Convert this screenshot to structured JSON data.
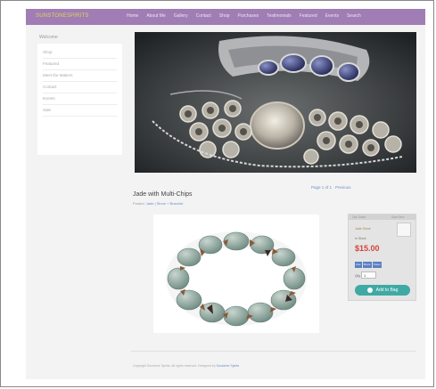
{
  "site": {
    "logo": "SUNSTONESPIRITS",
    "nav": [
      "Home",
      "About Me",
      "Gallery",
      "Contact",
      "Shop",
      "Purchases",
      "Testimonials",
      "Featured",
      "Events",
      "Search"
    ]
  },
  "sidebar": {
    "title": "Welcome",
    "items": [
      "Shop",
      "Featured",
      "Meet the Makers",
      "Contact",
      "Events",
      "Sale"
    ]
  },
  "hero": {
    "icon": "hero-photo"
  },
  "product": {
    "pager": "Page 1 of 1 · Previous",
    "title": "Jade with Multi-Chips",
    "category_prefix": "Posted:",
    "category_links": "Jade | Stone + Bracelet"
  },
  "buybox": {
    "head_left": "Like  Share",
    "head_right": "Save Item",
    "line1": "Jade Stone",
    "line2": "In Stock",
    "price": "$15.00",
    "social": [
      "Like",
      "Share",
      "Tweet"
    ],
    "qty_label": "Qty",
    "qty_value": "1",
    "cart_label": "Add to Bag"
  },
  "footer": {
    "text": "Copyright Sunstone Spirits. All rights reserved. Designed by",
    "link": "Sunstone Spirits"
  },
  "colors": {
    "topbar": "#a07db4",
    "logo": "#e5d35a",
    "price": "#d2453a",
    "cart": "#3fa9a4",
    "link": "#6f8fc6"
  }
}
